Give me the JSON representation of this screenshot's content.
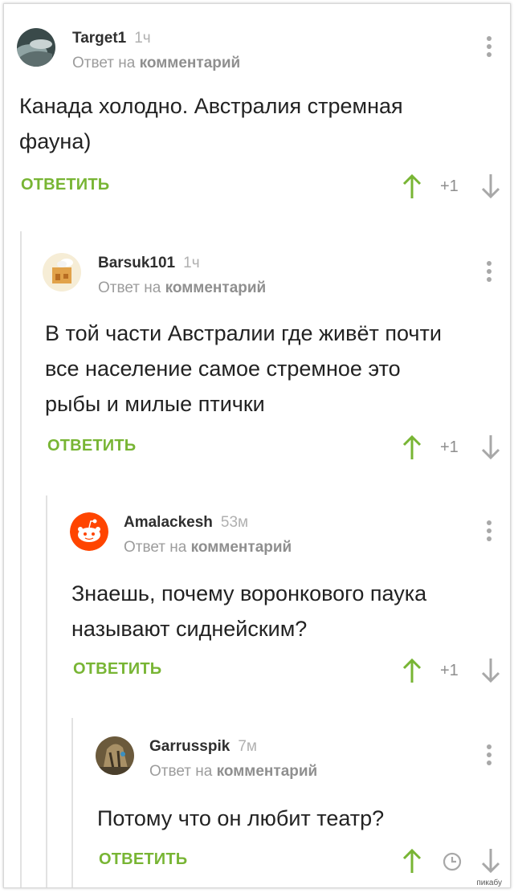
{
  "comments": [
    {
      "username": "Target1",
      "time": "1ч",
      "reply_prefix": "Ответ на",
      "reply_target": "комментарий",
      "text_lines": [
        "Канада холодно. Австралия стремная",
        "фауна)"
      ],
      "reply_label": "ОТВЕТИТЬ",
      "score": "+1"
    },
    {
      "username": "Barsuk101",
      "time": "1ч",
      "reply_prefix": "Ответ на",
      "reply_target": "комментарий",
      "text_lines": [
        "В той части Австралии где живёт почти",
        "все население самое стремное это",
        "рыбы и милые птички"
      ],
      "reply_label": "ОТВЕТИТЬ",
      "score": "+1"
    },
    {
      "username": "Amalackesh",
      "time": "53м",
      "reply_prefix": "Ответ на",
      "reply_target": "комментарий",
      "text_lines": [
        "Знаешь, почему воронкового паука",
        "называют сиднейским?"
      ],
      "reply_label": "ОТВЕТИТЬ",
      "score": "+1"
    },
    {
      "username": "Garrusspik",
      "time": "7м",
      "reply_prefix": "Ответ на",
      "reply_target": "комментарий",
      "text_lines": [
        "Потому что он любит театр?"
      ],
      "reply_label": "ОТВЕТИТЬ"
    }
  ],
  "watermark": "пикабу",
  "colors": {
    "accent": "#78b534",
    "thread_line": "#e2e2e2",
    "text": "#222222",
    "muted": "#9c9c9c"
  },
  "icons": {
    "upvote": "arrow-up-icon",
    "downvote": "arrow-down-icon",
    "menu": "kebab-menu-icon",
    "pending": "clock-icon"
  }
}
